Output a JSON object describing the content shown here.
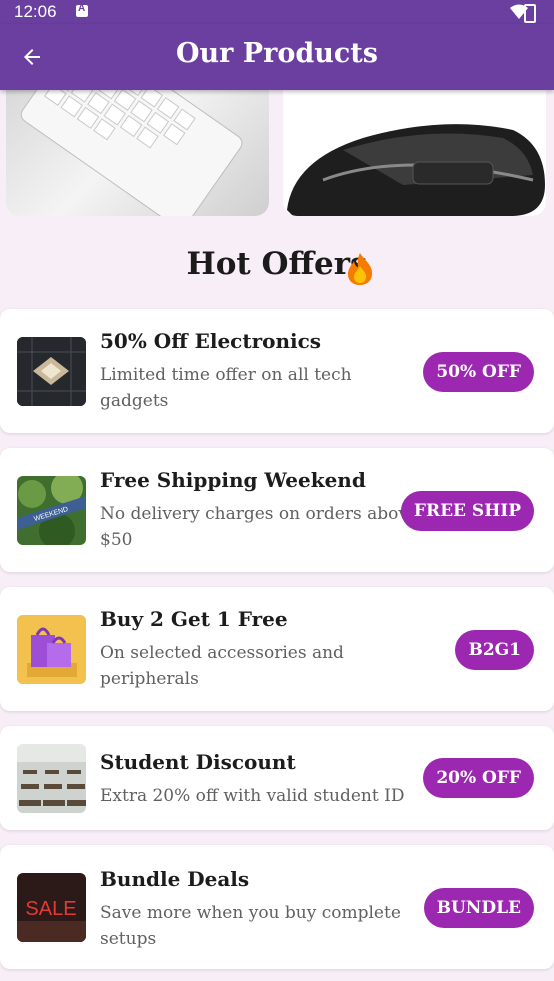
{
  "status_bar": {
    "time": "12:06"
  },
  "app_bar": {
    "title": "Our Products"
  },
  "hot_offers": {
    "title": "Hot Offers"
  },
  "offers": [
    {
      "title": "50% Off Electronics",
      "description": "Limited time offer on all tech gadgets",
      "badge": "50% OFF",
      "image": "chip-image"
    },
    {
      "title": "Free Shipping Weekend",
      "description": "No delivery charges on orders above $50",
      "badge": "FREE SHIP",
      "image": "weekend-sign-image"
    },
    {
      "title": "Buy 2 Get 1 Free",
      "description": "On selected accessories and peripherals",
      "badge": "B2G1",
      "image": "shopping-bags-image"
    },
    {
      "title": "Student Discount",
      "description": "Extra 20% off with valid student ID",
      "badge": "20% OFF",
      "image": "classroom-image"
    },
    {
      "title": "Bundle Deals",
      "description": "Save more when you buy complete setups",
      "badge": "BUNDLE",
      "image": "sale-sign-image"
    }
  ],
  "sale_sign_text": "SALE",
  "weekend_sign_text": "WEEKEND",
  "colors": {
    "primary": "#6A3FA0",
    "badge": "#9C27B0",
    "background": "#F8EEF8"
  }
}
